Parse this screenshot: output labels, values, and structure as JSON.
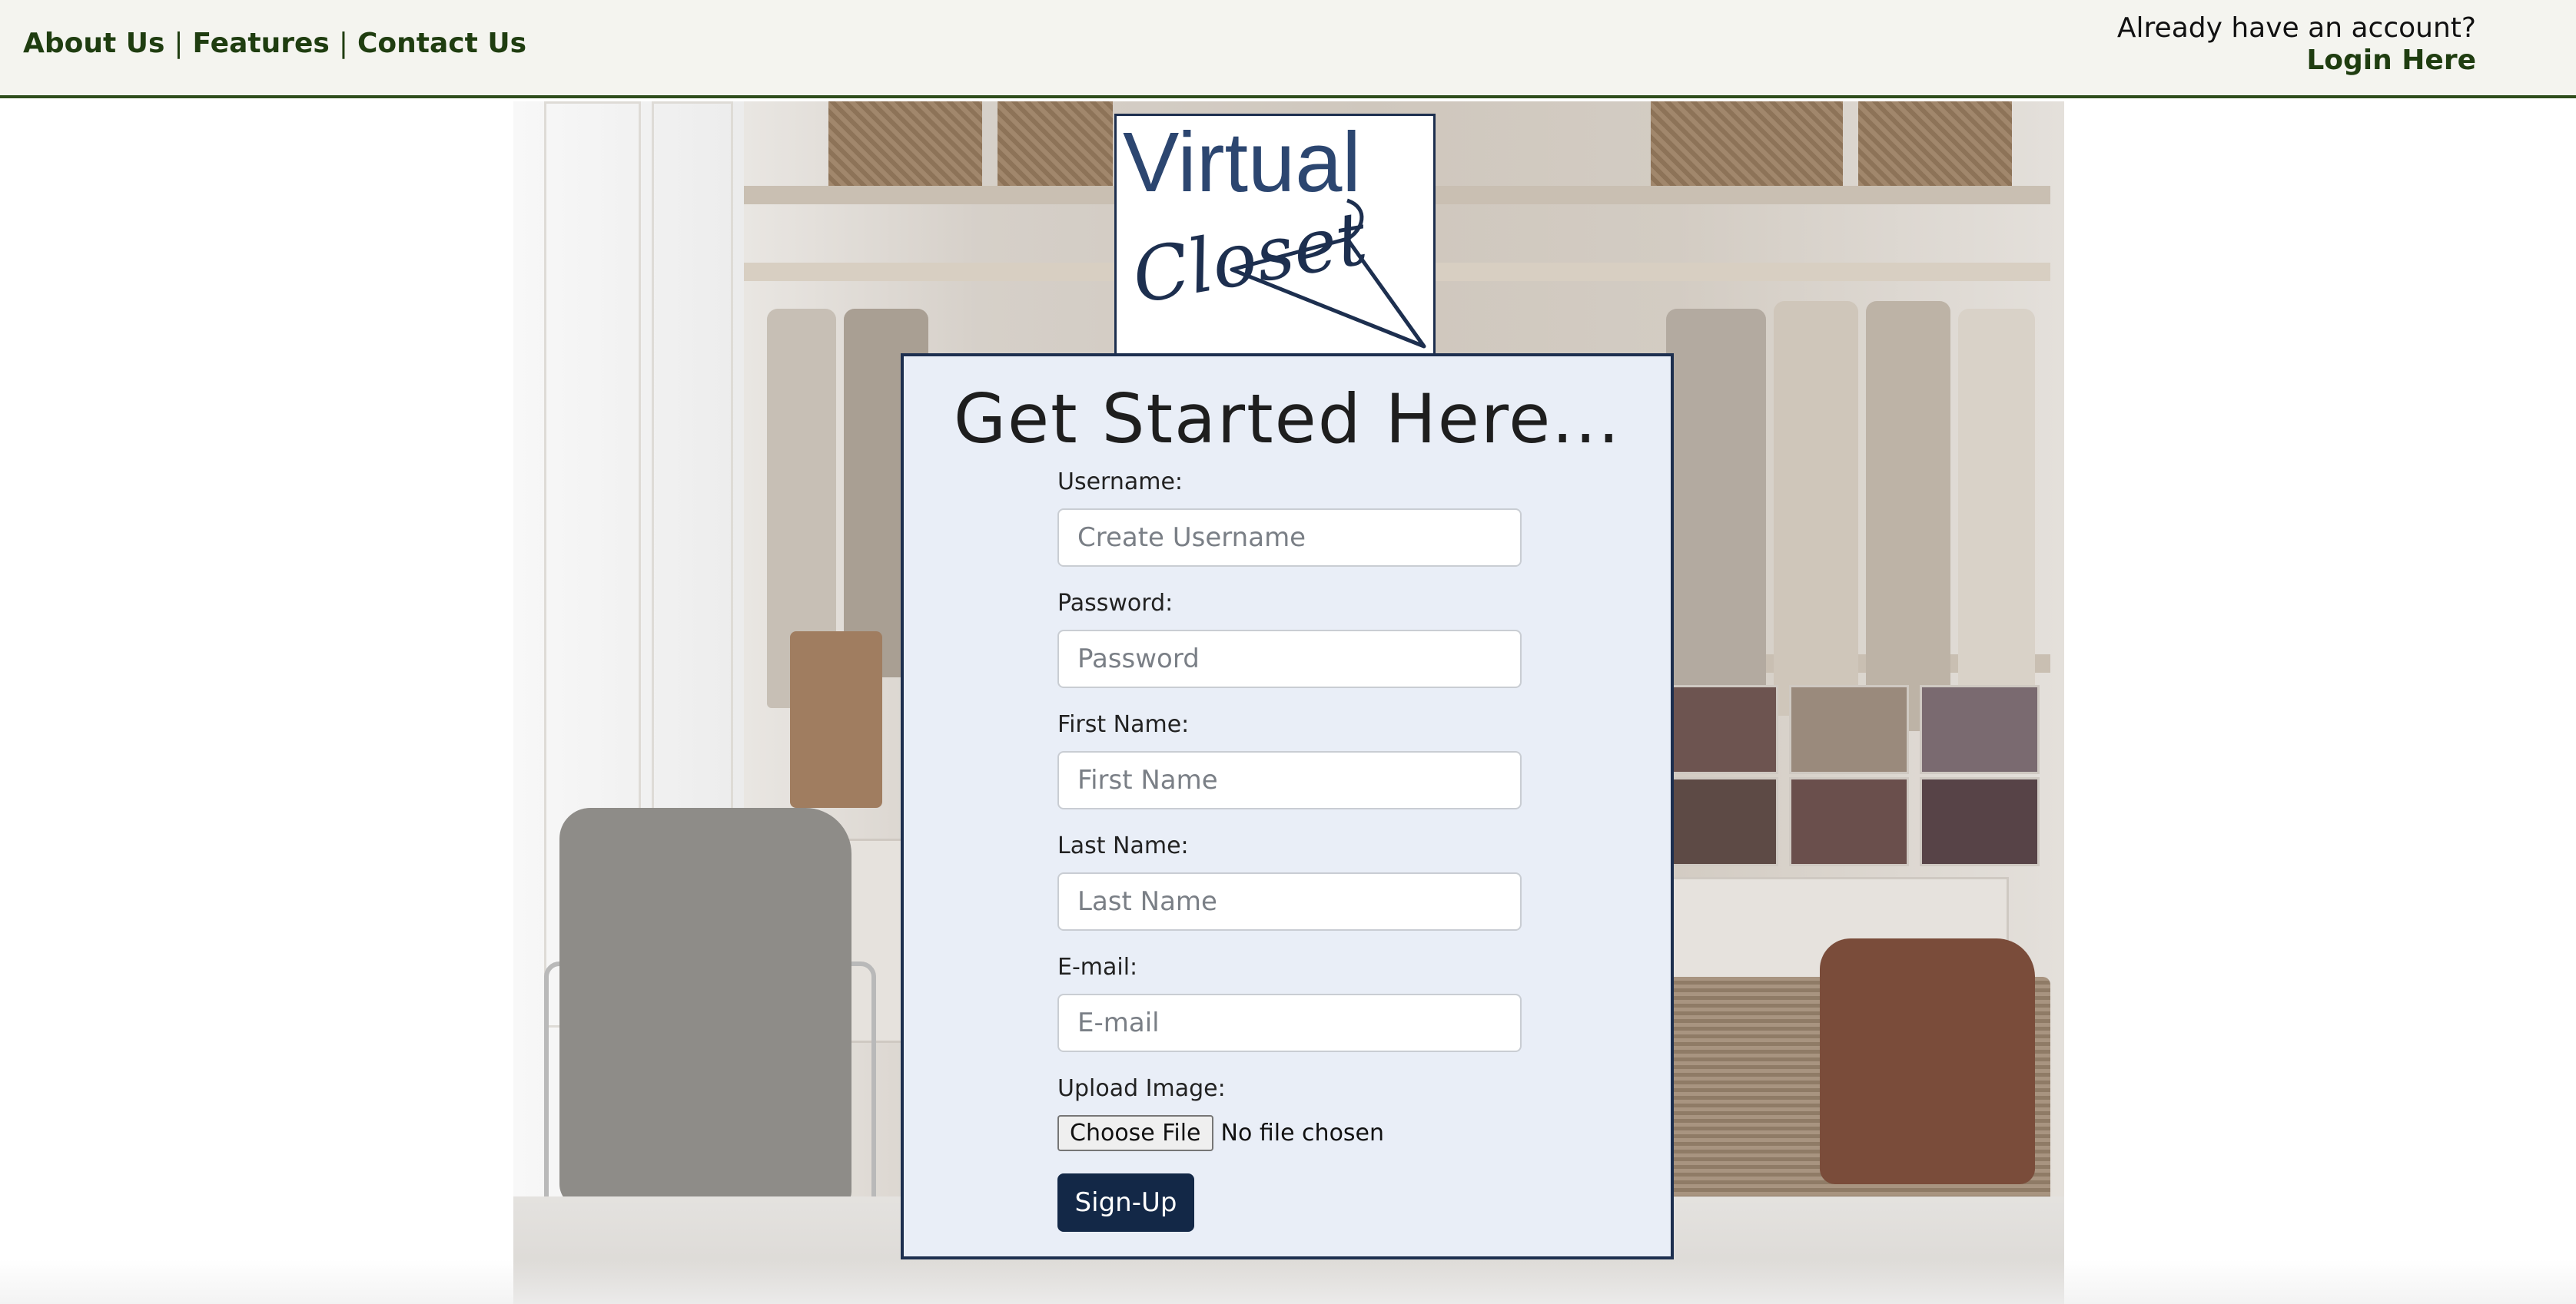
{
  "nav": {
    "links": [
      "About Us",
      "Features",
      "Contact Us"
    ],
    "separator": "|"
  },
  "account": {
    "prompt": "Already have an account?",
    "login_link": "Login Here"
  },
  "logo": {
    "word1": "Virtual",
    "word2": "Closet"
  },
  "form": {
    "title": "Get Started Here...",
    "fields": [
      {
        "label": "Username:",
        "placeholder": "Create Username"
      },
      {
        "label": "Password:",
        "placeholder": "Password"
      },
      {
        "label": "First Name:",
        "placeholder": "First Name"
      },
      {
        "label": "Last Name:",
        "placeholder": "Last Name"
      },
      {
        "label": "E-mail:",
        "placeholder": "E-mail"
      }
    ],
    "upload_label": "Upload Image:",
    "choose_file_label": "Choose File",
    "file_status": "No file chosen",
    "submit_label": "Sign-Up"
  },
  "colors": {
    "nav_text": "#1f3d10",
    "card_background": "#e9eef7",
    "card_border": "#1d2f4f",
    "button_background": "#132847"
  }
}
